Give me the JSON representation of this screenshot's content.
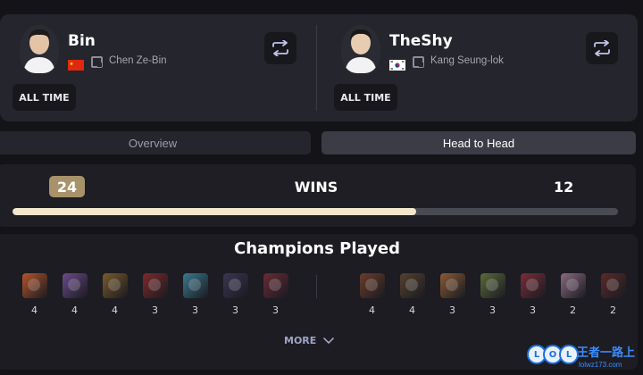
{
  "players": [
    {
      "name": "Bin",
      "real_name": "Chen Ze-Bin",
      "flag": "china-flag",
      "filter_label": "ALL TIME"
    },
    {
      "name": "TheShy",
      "real_name": "Kang Seung-lok",
      "flag": "korea-flag",
      "filter_label": "ALL TIME"
    }
  ],
  "tabs": [
    {
      "label": "Overview",
      "active": false
    },
    {
      "label": "Head to Head",
      "active": true
    }
  ],
  "wins": {
    "label": "WINS",
    "left": "24",
    "right": "12",
    "left_share": 0.667
  },
  "champions": {
    "title": "Champions Played",
    "left": [
      {
        "icon": "champion-1-icon",
        "count": "4",
        "color": "#b5542a"
      },
      {
        "icon": "champion-2-icon",
        "count": "4",
        "color": "#6b4a8a"
      },
      {
        "icon": "champion-3-icon",
        "count": "4",
        "color": "#7a5a2c"
      },
      {
        "icon": "champion-4-icon",
        "count": "3",
        "color": "#7d2a2a"
      },
      {
        "icon": "champion-5-icon",
        "count": "3",
        "color": "#3a7a8e"
      },
      {
        "icon": "champion-6-icon",
        "count": "3",
        "color": "#3b3552"
      },
      {
        "icon": "champion-7-icon",
        "count": "3",
        "color": "#6a2a35"
      }
    ],
    "right": [
      {
        "icon": "champion-8-icon",
        "count": "4",
        "color": "#6a3d2a"
      },
      {
        "icon": "champion-9-icon",
        "count": "4",
        "color": "#54422e"
      },
      {
        "icon": "champion-10-icon",
        "count": "3",
        "color": "#8a5a34"
      },
      {
        "icon": "champion-11-icon",
        "count": "3",
        "color": "#5b6a3a"
      },
      {
        "icon": "champion-12-icon",
        "count": "3",
        "color": "#7a2d3a"
      },
      {
        "icon": "champion-13-icon",
        "count": "2",
        "color": "#8a6a82"
      },
      {
        "icon": "champion-14-icon",
        "count": "2",
        "color": "#5a2a2a"
      }
    ],
    "more_label": "MORE"
  },
  "watermark": {
    "letters": [
      "L",
      "O",
      "L"
    ],
    "brand": "王者一路上",
    "url": "lolwz173.com"
  },
  "colors": {
    "accent_gold": "#a8926a",
    "bar_fill": "#f1e7ca"
  }
}
